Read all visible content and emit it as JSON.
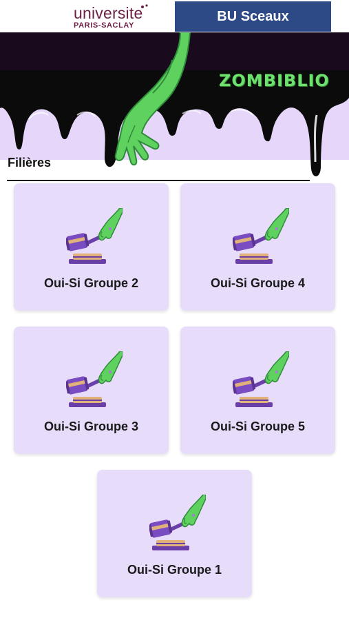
{
  "header": {
    "logo_word": "universite",
    "logo_sub": "PARIS-SACLAY",
    "library_button": "BU Sceaux"
  },
  "banner": {
    "brand": "ZOMBIBLIO",
    "section_title": "Filières"
  },
  "cards": [
    {
      "label": "Oui-Si Groupe 2",
      "icon": "zombie-gavel-icon"
    },
    {
      "label": "Oui-Si Groupe 4",
      "icon": "zombie-gavel-icon"
    },
    {
      "label": "Oui-Si Groupe 3",
      "icon": "zombie-gavel-icon"
    },
    {
      "label": "Oui-Si Groupe 5",
      "icon": "zombie-gavel-icon"
    },
    {
      "label": "Oui-Si Groupe 1",
      "icon": "zombie-gavel-icon"
    }
  ],
  "colors": {
    "logo": "#6b1e45",
    "library_button_bg": "#2e4a86",
    "card_bg": "#e8dcfb",
    "banner_bg": "#e5d6fa",
    "zombie_green": "#6ee06e"
  }
}
